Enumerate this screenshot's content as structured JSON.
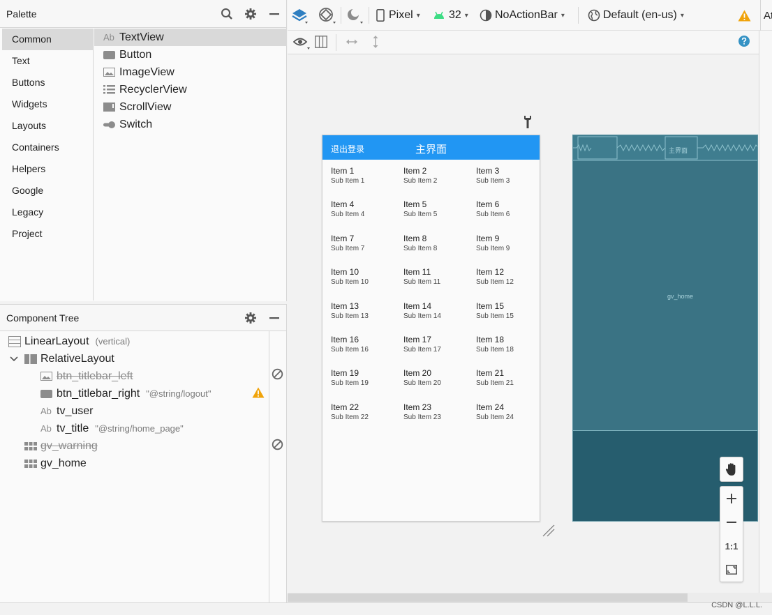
{
  "palette": {
    "title": "Palette",
    "categories": [
      "Common",
      "Text",
      "Buttons",
      "Widgets",
      "Layouts",
      "Containers",
      "Helpers",
      "Google",
      "Legacy",
      "Project"
    ],
    "widgets": [
      {
        "icon_text": "Ab",
        "label": "TextView"
      },
      {
        "icon_text": "",
        "label": "Button"
      },
      {
        "icon_text": "",
        "label": "ImageView"
      },
      {
        "icon_text": "",
        "label": "RecyclerView"
      },
      {
        "icon_text": "",
        "label": "ScrollView"
      },
      {
        "icon_text": "",
        "label": "Switch"
      }
    ]
  },
  "tree": {
    "title": "Component Tree",
    "nodes": [
      {
        "label": "LinearLayout",
        "attr": "(vertical)"
      },
      {
        "label": "RelativeLayout",
        "attr": ""
      },
      {
        "label": "btn_titlebar_left",
        "attr": ""
      },
      {
        "label": "btn_titlebar_right",
        "attr": "\"@string/logout\""
      },
      {
        "label": "tv_user",
        "attr": ""
      },
      {
        "label": "tv_title",
        "attr": "\"@string/home_page\""
      },
      {
        "label": "gv_warning",
        "attr": ""
      },
      {
        "label": "gv_home",
        "attr": ""
      }
    ],
    "node_icon_text": "Ab"
  },
  "toolbar": {
    "device": "Pixel",
    "api": "32",
    "theme": "NoActionBar",
    "locale": "Default (en-us)",
    "cut_label": "At"
  },
  "phone": {
    "logout": "退出登录",
    "title": "主界面",
    "items": [
      {
        "title": "Item 1",
        "sub": "Sub Item 1"
      },
      {
        "title": "Item 2",
        "sub": "Sub Item 2"
      },
      {
        "title": "Item 3",
        "sub": "Sub Item 3"
      },
      {
        "title": "Item 4",
        "sub": "Sub Item 4"
      },
      {
        "title": "Item 5",
        "sub": "Sub Item 5"
      },
      {
        "title": "Item 6",
        "sub": "Sub Item 6"
      },
      {
        "title": "Item 7",
        "sub": "Sub Item 7"
      },
      {
        "title": "Item 8",
        "sub": "Sub Item 8"
      },
      {
        "title": "Item 9",
        "sub": "Sub Item 9"
      },
      {
        "title": "Item 10",
        "sub": "Sub Item 10"
      },
      {
        "title": "Item 11",
        "sub": "Sub Item 11"
      },
      {
        "title": "Item 12",
        "sub": "Sub Item 12"
      },
      {
        "title": "Item 13",
        "sub": "Sub Item 13"
      },
      {
        "title": "Item 14",
        "sub": "Sub Item 14"
      },
      {
        "title": "Item 15",
        "sub": "Sub Item 15"
      },
      {
        "title": "Item 16",
        "sub": "Sub Item 16"
      },
      {
        "title": "Item 17",
        "sub": "Sub Item 17"
      },
      {
        "title": "Item 18",
        "sub": "Sub Item 18"
      },
      {
        "title": "Item 19",
        "sub": "Sub Item 19"
      },
      {
        "title": "Item 20",
        "sub": "Sub Item 20"
      },
      {
        "title": "Item 21",
        "sub": "Sub Item 21"
      },
      {
        "title": "Item 22",
        "sub": "Sub Item 22"
      },
      {
        "title": "Item 23",
        "sub": "Sub Item 23"
      },
      {
        "title": "Item 24",
        "sub": "Sub Item 24"
      }
    ]
  },
  "blueprint": {
    "title_label": "主界面",
    "grid_label": "gv_home"
  },
  "zoom": {
    "reset_label": "1:1"
  },
  "watermark": "CSDN @L.L.L.",
  "colors": {
    "titlebar": "#2196f3",
    "blueprint": "#3a7384",
    "warning": "#f0a30a",
    "help": "#3592c4"
  }
}
